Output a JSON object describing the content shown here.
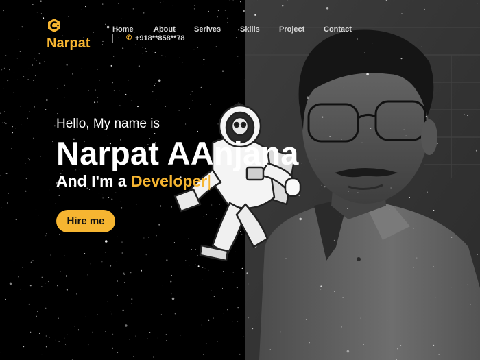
{
  "brand": {
    "name": "Narpat",
    "logo_icon": "c-hexagon-logo",
    "accent_color": "#f6b531"
  },
  "nav": {
    "items": [
      {
        "label": "Home"
      },
      {
        "label": "About"
      },
      {
        "label": "Serives"
      },
      {
        "label": "Skills"
      },
      {
        "label": "Project"
      },
      {
        "label": "Contact"
      }
    ],
    "phone": {
      "icon": "phone-icon",
      "number": "+918**858**78"
    }
  },
  "hero": {
    "greeting": "Hello, My name is",
    "name": "Narpat AAnjana",
    "role_prefix": "And I'm a ",
    "role_word": "Developer",
    "cursor": "|",
    "cta_label": "Hire me"
  },
  "images": {
    "astronaut": "astronaut-illustration",
    "portrait": "profile-photo"
  }
}
